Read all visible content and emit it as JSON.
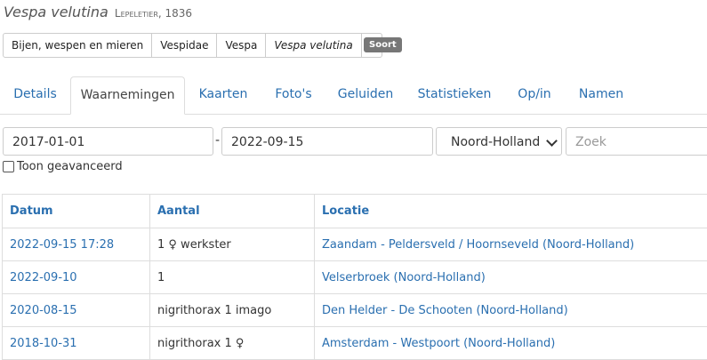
{
  "species": {
    "name": "Vespa velutina",
    "author": "Lepeletier",
    "year": ", 1836"
  },
  "breadcrumb": [
    "Bijen, wespen en mieren",
    "Vespidae",
    "Vespa",
    "Vespa velutina"
  ],
  "sort_badge": "Soort",
  "tabs": [
    "Details",
    "Waarnemingen",
    "Kaarten",
    "Foto's",
    "Geluiden",
    "Statistieken",
    "Op/in",
    "Namen"
  ],
  "filters": {
    "date_from": "2017-01-01",
    "separator": "-",
    "date_to": "2022-09-15",
    "province": "Noord-Holland",
    "search_placeholder": "Zoek",
    "advanced_label": "Toon geavanceerd"
  },
  "table": {
    "headers": [
      "Datum",
      "Aantal",
      "Locatie"
    ],
    "rows": [
      {
        "date": "2022-09-15 17:28",
        "count": "1 ♀ werkster",
        "location": "Zaandam - Peldersveld / Hoornseveld (Noord-Holland)"
      },
      {
        "date": "2022-09-10",
        "count": "1",
        "location": "Velserbroek (Noord-Holland)"
      },
      {
        "date": "2020-08-15",
        "count": "nigrithorax 1 imago",
        "location": "Den Helder - De Schooten (Noord-Holland)"
      },
      {
        "date": "2018-10-31",
        "count": "nigrithorax 1 ♀",
        "location": "Amsterdam - Westpoort (Noord-Holland)"
      }
    ]
  }
}
